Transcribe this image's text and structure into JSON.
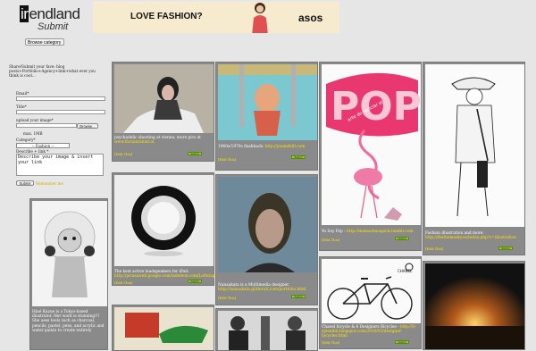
{
  "logo": {
    "ir": "ir",
    "rest": "endland",
    "submit": "Submit"
  },
  "banner": {
    "text": "LOVE FASHION?",
    "brand": "asos"
  },
  "browse": {
    "label": "Browse category"
  },
  "form": {
    "intro": "Share/Submit your fave: blog posts+Portfolio+Agency+link+what ever you think is cool...",
    "email_label": "Email*",
    "title_label": "Title*",
    "upload_label": "upload your image*",
    "browse_btn": "Browse...",
    "max": "max. 1MB",
    "category_label": "Category*",
    "category_value": "-- Fashion --",
    "describe_label": "Describe + link *",
    "describe_value": "Describe your image & insert your link",
    "submit_btn": "Submit",
    "remember": "Remember me"
  },
  "cards": [
    {
      "caption": "psychadelic shooting at vienna, more pics at ",
      "link": "www.florianrainer.at",
      "edit": "[Edit This]",
      "button": "Submit"
    },
    {
      "caption": "1960s/1970s flashback: ",
      "link": "http://jeuandrill.com",
      "edit": "[Edit This]",
      "button": "Submit"
    },
    {
      "caption": "Yo Soy Pop - ",
      "link": "http://mamachusapick.tumblr.com",
      "edit": "[Edit This]",
      "button": "Submit",
      "pop_text": "POP",
      "vert_text": "arte de reciclar el"
    },
    {
      "caption": "Fashion illustration and more. ",
      "link": "http://thethomasky.es/index.php?s=illustration",
      "edit": "[Edit This]",
      "button": "Submit"
    },
    {
      "caption": "The best active loudspeakers for iPad: ",
      "link": "http://picasaweb.google.com/mdeleon.com/Loftstagelsst",
      "edit": "[Edit This]",
      "button": "Submit"
    },
    {
      "caption": "Nanaakata is a Multimedia designer. ",
      "link": "http://nanaakata.glitterati.com/portfolio.html",
      "edit": "[Edit This]",
      "button": "Submit"
    },
    {
      "caption": "Chanel bicycle & 6 Designers Bicycles - ",
      "link": "http://lt-splendid.blogspot.com/2010/03/designer-bicycles.html",
      "edit": "[Edit This]",
      "button": "Submit",
      "logo_text": "CHANEL"
    },
    {
      "caption": "Hiné Kazue is a Tokyo-based illustrator. Her work is stunning!!! She uses tools such as charcoal, pencils, pastel, pens, and acrylic and water paints to create entirely"
    }
  ]
}
